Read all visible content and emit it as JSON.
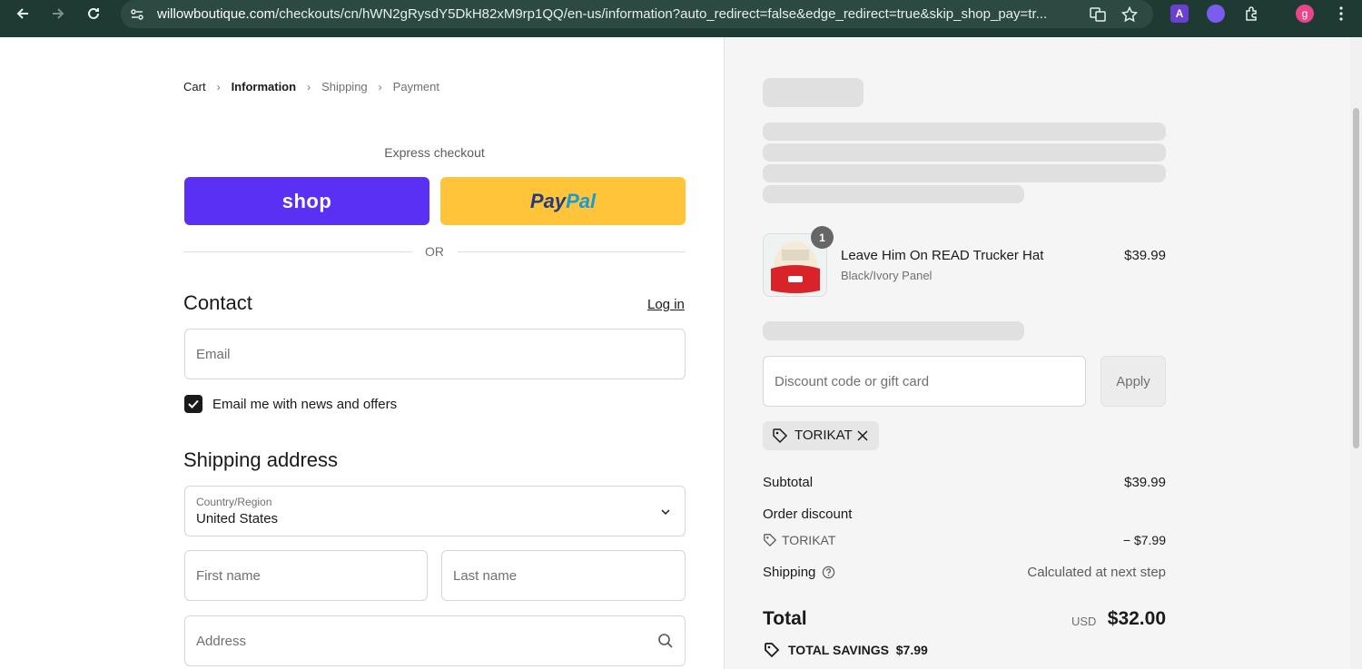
{
  "browser": {
    "url_host": "willowboutique.com",
    "url_path": "/checkouts/cn/hWN2gRysdY5DkH82xM9rp1QQ/en-us/information?auto_redirect=false&edge_redirect=true&skip_shop_pay=tr...",
    "profile_initial": "g",
    "ext_a_label": "A"
  },
  "breadcrumb": {
    "cart": "Cart",
    "information": "Information",
    "shipping": "Shipping",
    "payment": "Payment"
  },
  "express": {
    "label": "Express checkout",
    "shop_label": "shop",
    "paypal_part1": "Pay",
    "paypal_part2": "Pal",
    "or": "OR"
  },
  "contact": {
    "heading": "Contact",
    "login": "Log in",
    "email_placeholder": "Email",
    "newsletter_label": "Email me with news and offers",
    "newsletter_checked": true
  },
  "shipping_address": {
    "heading": "Shipping address",
    "country_label": "Country/Region",
    "country_value": "United States",
    "first_name_placeholder": "First name",
    "last_name_placeholder": "Last name",
    "address_placeholder": "Address"
  },
  "summary": {
    "product": {
      "name": "Leave Him On READ Trucker Hat",
      "variant": "Black/Ivory Panel",
      "price": "$39.99",
      "quantity": "1"
    },
    "discount_placeholder": "Discount code or gift card",
    "apply_label": "Apply",
    "applied_code": "TORIKAT",
    "subtotal_label": "Subtotal",
    "subtotal_value": "$39.99",
    "order_discount_label": "Order discount",
    "discount_code": "TORIKAT",
    "discount_value": "− $7.99",
    "shipping_label": "Shipping",
    "shipping_value": "Calculated at next step",
    "total_label": "Total",
    "currency": "USD",
    "total_value": "$32.00",
    "savings_label": "TOTAL SAVINGS",
    "savings_value": "$7.99"
  },
  "colors": {
    "shop_purple": "#5a31f4",
    "paypal_yellow": "#ffc439",
    "browser_bar": "#1f3a33"
  }
}
